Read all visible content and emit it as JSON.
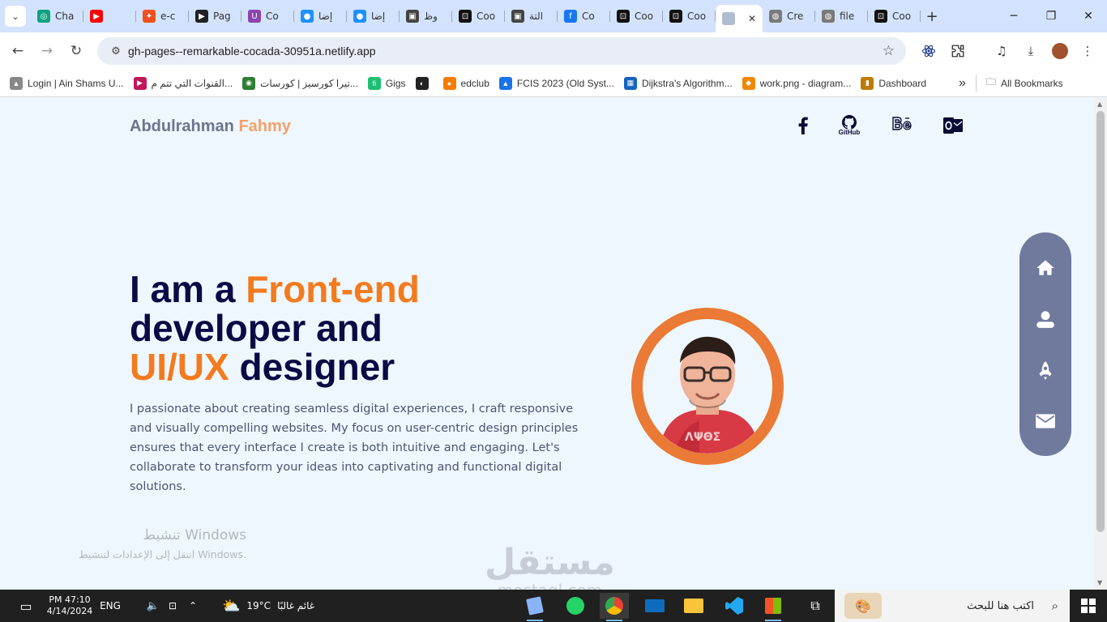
{
  "browser": {
    "tabs": [
      {
        "label": "Cha",
        "color": "#10a37f",
        "glyph": "◎"
      },
      {
        "label": "",
        "color": "#ff0000",
        "glyph": "▶"
      },
      {
        "label": "e-c",
        "color": "#f24e1e",
        "glyph": "✦"
      },
      {
        "label": "Pag",
        "color": "#202124",
        "glyph": "▶"
      },
      {
        "label": "Co",
        "color": "#8e44ad",
        "glyph": "U"
      },
      {
        "label": "إضا",
        "color": "#1e90ff",
        "glyph": "●"
      },
      {
        "label": "إضا",
        "color": "#1e90ff",
        "glyph": "●"
      },
      {
        "label": "وظ",
        "color": "#444444",
        "glyph": "▣"
      },
      {
        "label": "Coo",
        "color": "#111111",
        "glyph": "⊡"
      },
      {
        "label": "التة",
        "color": "#444444",
        "glyph": "▣"
      },
      {
        "label": "Co",
        "color": "#1877f2",
        "glyph": "f"
      },
      {
        "label": "Coo",
        "color": "#111111",
        "glyph": "⊡"
      },
      {
        "label": "Coo",
        "color": "#111111",
        "glyph": "⊡"
      }
    ],
    "active_tab_close": "✕",
    "tabs_after": [
      {
        "label": "Cre",
        "color": "#7a7a7a",
        "glyph": "◍"
      },
      {
        "label": "file",
        "color": "#7a7a7a",
        "glyph": "◍"
      },
      {
        "label": "Coo",
        "color": "#111111",
        "glyph": "⊡"
      }
    ],
    "new_tab": "+",
    "url": "gh-pages--remarkable-cocada-30951a.netlify.app",
    "bookmarks": [
      {
        "label": "Login | Ain Shams U...",
        "color": "#888888",
        "glyph": "▲"
      },
      {
        "label": "القنوات التي تتم م...",
        "color": "#c2185b",
        "glyph": "▶"
      },
      {
        "label": "تيرا كورسيز | كورسات...",
        "color": "#2e7d32",
        "glyph": "◉"
      },
      {
        "label": "Gigs",
        "color": "#1dbf73",
        "glyph": "fi"
      },
      {
        "label": "",
        "color": "#222222",
        "glyph": "◐"
      },
      {
        "label": "edclub",
        "color": "#f57c00",
        "glyph": "●"
      },
      {
        "label": "FCIS 2023 (Old Syst...",
        "color": "#1a73e8",
        "glyph": "▲"
      },
      {
        "label": "Dijkstra's Algorithm...",
        "color": "#1565c0",
        "glyph": "▦"
      },
      {
        "label": "work.png - diagram...",
        "color": "#f08705",
        "glyph": "◆"
      },
      {
        "label": "Dashboard",
        "color": "#c07a00",
        "glyph": "▮"
      }
    ],
    "bookmarks_more": "»",
    "all_bookmarks": "All Bookmarks"
  },
  "page": {
    "brand_first": "Abdulrahman",
    "brand_last": "Fahmy",
    "social": [
      "facebook-icon",
      "github-icon",
      "behance-icon",
      "outlook-icon"
    ],
    "github_label": "GitHub",
    "hero": {
      "l1_a": "I am a ",
      "l1_b": "Front-end",
      "l2": "developer and",
      "l3_a": "UI/UX",
      "l3_b": " designer"
    },
    "description": "I passionate about creating seamless digital experiences, I craft responsive and visually compelling websites. My focus on user-centric design principles ensures that every interface I create is both intuitive and engaging. Let's collaborate to transform your ideas into captivating and functional digital solutions.",
    "accent_color": "#f47a1e",
    "nav_icons": [
      "home-icon",
      "user-icon",
      "rocket-icon",
      "mail-icon"
    ]
  },
  "overlay": {
    "activate_title": "تنشيط Windows",
    "activate_sub": "انتقل إلى الإعدادات لتنشيط Windows.",
    "mostaql_ar": "مستقل",
    "mostaql_en": "mostaql.com"
  },
  "taskbar": {
    "time": "PM 47:10",
    "date": "4/14/2024",
    "lang": "ENG",
    "weather_temp": "19°C",
    "weather_text": "غائم غالبًا",
    "search_placeholder": "اكتب هنا للبحث"
  }
}
